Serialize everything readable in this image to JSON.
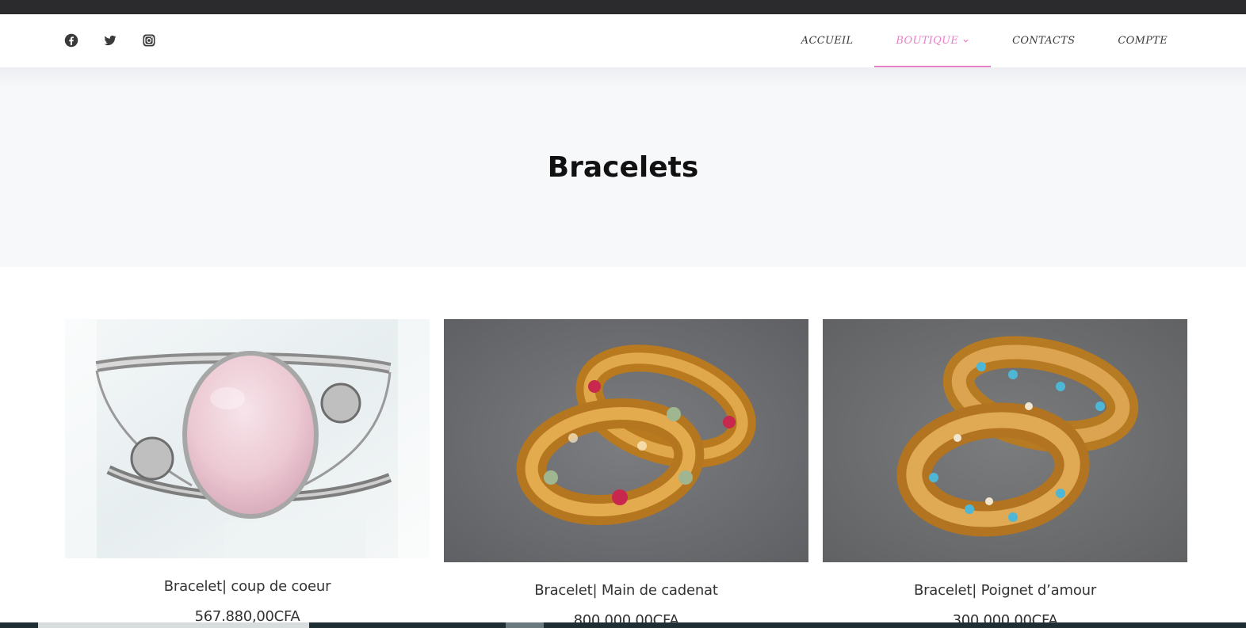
{
  "social": {
    "icons": [
      "facebook-icon",
      "twitter-icon",
      "instagram-icon"
    ]
  },
  "nav": {
    "items": [
      {
        "label": "ACCUEIL"
      },
      {
        "label": "BOUTIQUE"
      },
      {
        "label": "CONTACTS"
      },
      {
        "label": "COMPTE"
      }
    ],
    "active_index": 1,
    "accent_color": "#e87fc8"
  },
  "page": {
    "title": "Bracelets"
  },
  "products": [
    {
      "title": "Bracelet| coup de coeur",
      "price": "567.880,00CFA",
      "image": "silver-cuff-rose-quartz"
    },
    {
      "title": "Bracelet| Main de cadenat",
      "price": "800.000,00CFA",
      "image": "gold-bangles-red-green-stones"
    },
    {
      "title": "Bracelet| Poignet d’amour",
      "price": "300.000,00CFA",
      "image": "gold-bangles-turquoise-stones"
    }
  ]
}
